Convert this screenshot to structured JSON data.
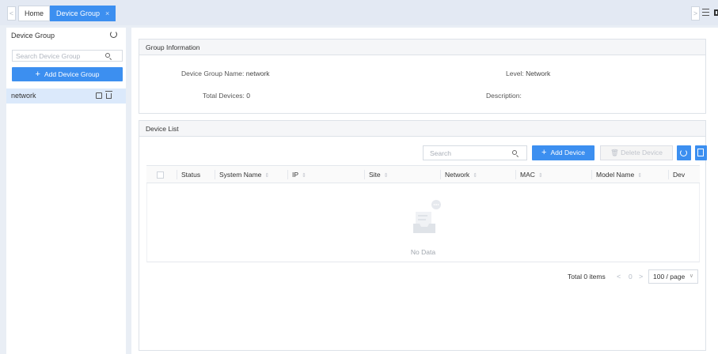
{
  "tabs": {
    "home": "Home",
    "active": "Device Group",
    "close": "×",
    "prev_arrow": "<",
    "next_arrow": ">"
  },
  "sidebar": {
    "title": "Device Group",
    "search_placeholder": "Search Device Group",
    "add_button": "Add Device Group",
    "groups": [
      {
        "name": "network"
      }
    ]
  },
  "group_info": {
    "title": "Group Information",
    "name_label": "Device Group Name:",
    "name_value": "network",
    "level_label": "Level:",
    "level_value": "Network",
    "total_label": "Total Devices:",
    "total_value": "0",
    "description_label": "Description:",
    "description_value": ""
  },
  "device_list": {
    "title": "Device List",
    "search_placeholder": "Search",
    "add_button": "Add Device",
    "delete_button": "Delete Device",
    "columns": [
      "Status",
      "System Name",
      "IP",
      "Site",
      "Network",
      "MAC",
      "Model Name",
      "Dev"
    ],
    "empty_text": "No Data",
    "total_text": "Total 0 items",
    "current_page": "0",
    "page_size": "100 / page"
  },
  "colors": {
    "primary": "#3c8ff0",
    "selected_row": "#dbe9fb"
  }
}
